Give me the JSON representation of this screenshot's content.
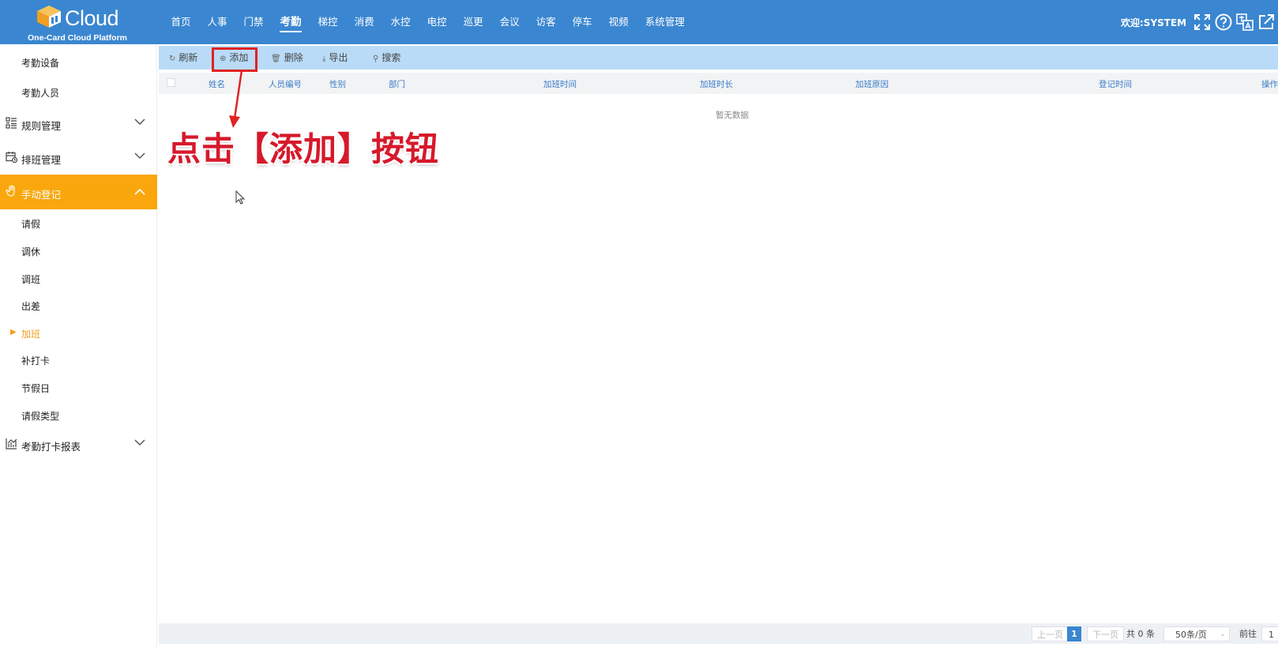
{
  "header": {
    "logo_text": "Cloud",
    "logo_subtitle": "One-Card Cloud Platform",
    "nav": [
      {
        "label": "首页",
        "active": false
      },
      {
        "label": "人事",
        "active": false
      },
      {
        "label": "门禁",
        "active": false
      },
      {
        "label": "考勤",
        "active": true
      },
      {
        "label": "梯控",
        "active": false
      },
      {
        "label": "消费",
        "active": false
      },
      {
        "label": "水控",
        "active": false
      },
      {
        "label": "电控",
        "active": false
      },
      {
        "label": "巡更",
        "active": false
      },
      {
        "label": "会议",
        "active": false
      },
      {
        "label": "访客",
        "active": false
      },
      {
        "label": "停车",
        "active": false
      },
      {
        "label": "视频",
        "active": false
      },
      {
        "label": "系统管理",
        "active": false
      }
    ],
    "welcome": "欢迎:SYSTEM",
    "icons": [
      "fullscreen-icon",
      "help-icon",
      "language-icon",
      "external-link-icon"
    ]
  },
  "sidebar": {
    "top_items": [
      {
        "label": "考勤设备"
      },
      {
        "label": "考勤人员"
      }
    ],
    "groups": [
      {
        "label": "规则管理",
        "icon": "list-icon",
        "expanded": false
      },
      {
        "label": "排班管理",
        "icon": "calendar-icon",
        "expanded": false
      },
      {
        "label": "手动登记",
        "icon": "hand-icon",
        "expanded": true
      }
    ],
    "sub_items": [
      {
        "label": "请假",
        "active": false
      },
      {
        "label": "调休",
        "active": false
      },
      {
        "label": "调班",
        "active": false
      },
      {
        "label": "出差",
        "active": false
      },
      {
        "label": "加班",
        "active": true
      },
      {
        "label": "补打卡",
        "active": false
      },
      {
        "label": "节假日",
        "active": false
      },
      {
        "label": "请假类型",
        "active": false
      }
    ],
    "report_group": {
      "label": "考勤打卡报表",
      "icon": "chart-icon",
      "expanded": false
    }
  },
  "toolbar": {
    "refresh": "刷新",
    "add": "添加",
    "delete": "删除",
    "export": "导出",
    "search": "搜索"
  },
  "table": {
    "columns": [
      "姓名",
      "人员编号",
      "性别",
      "部门",
      "加班时间",
      "加班时长",
      "加班原因",
      "登记时间",
      "操作"
    ],
    "rows": [],
    "empty_text": "暂无数据"
  },
  "annotation": {
    "text": "点击【添加】按钮",
    "color": "#d6192b"
  },
  "pagination": {
    "prev": "上一页",
    "current_page": "1",
    "next": "下一页",
    "total": "共 0 条",
    "page_size": "50条/页",
    "goto_label": "前往",
    "goto_value": "1"
  },
  "colors": {
    "header_bg": "#3a86d0",
    "active_group_bg": "#f9a70d",
    "toolbar_bg": "#b9dbf7",
    "highlight_border": "#e12222"
  }
}
